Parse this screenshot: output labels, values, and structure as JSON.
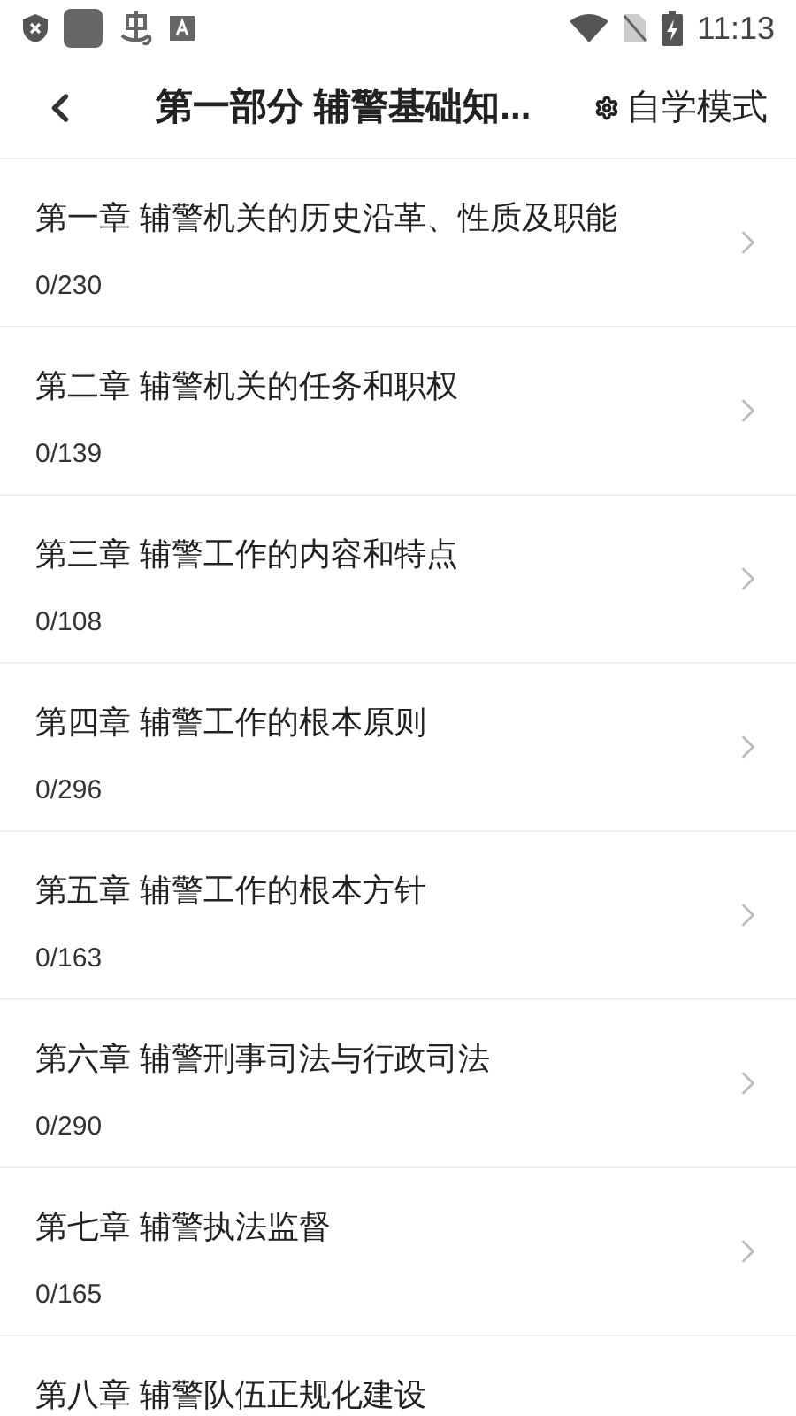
{
  "status_bar": {
    "time": "11:13"
  },
  "header": {
    "title": "第一部分 辅警基础知...",
    "mode_button": "自学模式"
  },
  "chapters": [
    {
      "title": "第一章 辅警机关的历史沿革、性质及职能",
      "count": "0/230"
    },
    {
      "title": "第二章 辅警机关的任务和职权",
      "count": "0/139"
    },
    {
      "title": "第三章 辅警工作的内容和特点",
      "count": "0/108"
    },
    {
      "title": "第四章 辅警工作的根本原则",
      "count": "0/296"
    },
    {
      "title": "第五章 辅警工作的根本方针",
      "count": "0/163"
    },
    {
      "title": "第六章 辅警刑事司法与行政司法",
      "count": "0/290"
    },
    {
      "title": "第七章 辅警执法监督",
      "count": "0/165"
    },
    {
      "title": "第八章 辅警队伍正规化建设"
    }
  ]
}
